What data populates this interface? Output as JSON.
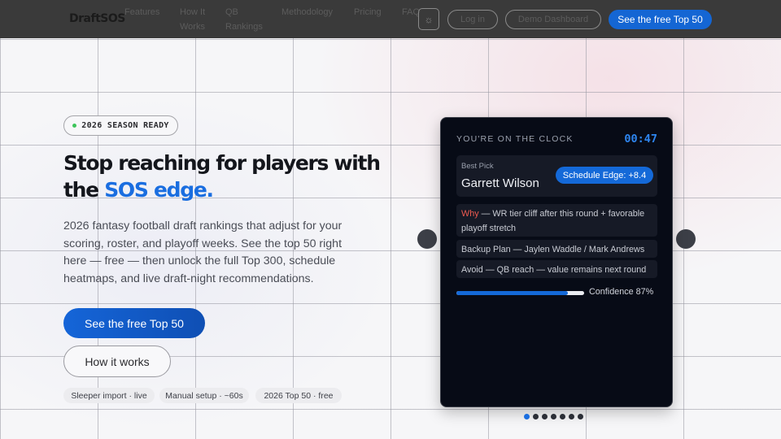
{
  "nav": {
    "brand": "DraftSOS",
    "links": [
      {
        "line1": "Features",
        "line2": ""
      },
      {
        "line1": "How It",
        "line2": "Works"
      },
      {
        "line1": "QB",
        "line2": "Rankings"
      },
      {
        "line1": "Methodology",
        "line2": ""
      },
      {
        "line1": "Pricing",
        "line2": ""
      },
      {
        "line1": "FAQ",
        "line2": ""
      }
    ],
    "theme_icon": "sun-icon",
    "login": "Log in",
    "demo": "Demo Dashboard",
    "cta": "See the free Top 50"
  },
  "hero": {
    "badge": "2026 SEASON READY",
    "headline_part1": "Stop reaching for players with the ",
    "headline_accent": "SOS edge.",
    "subtext": "2026 fantasy football draft rankings that adjust for your scoring, roster, and playoff weeks. See the top 50 right here — free — then unlock the full Top 300, schedule heatmaps, and live draft-night recommendations.",
    "cta_primary": "See the free Top 50",
    "cta_secondary": "How it works",
    "chips": [
      "Sleeper import · live",
      "Manual setup · ~60s",
      "2026 Top 50 · free"
    ]
  },
  "card": {
    "heading": "YOU'RE ON THE CLOCK",
    "timer": "00:47",
    "pick_label": "Best Pick",
    "pick_name": "Garrett Wilson",
    "edge": "Schedule Edge: +8.4",
    "why_label": "Why",
    "why_text": " — WR tier cliff after this round + favorable playoff stretch",
    "backup": "Backup Plan — Jaylen Waddle / Mark Andrews",
    "avoid": "Avoid — QB reach — value remains next round",
    "confidence_text": "Confidence 87%",
    "confidence_value": 0.87
  },
  "carousel": {
    "prev_icon": "chevron-left-icon",
    "next_icon": "chevron-right-icon",
    "slide_count": 7,
    "active_index": 0
  },
  "colors": {
    "accent": "#1a6ee0",
    "card_bg": "#070b16",
    "nav_bg": "#3a3a3a",
    "why": "#ee5a50",
    "status_dot": "#3cc45a"
  }
}
